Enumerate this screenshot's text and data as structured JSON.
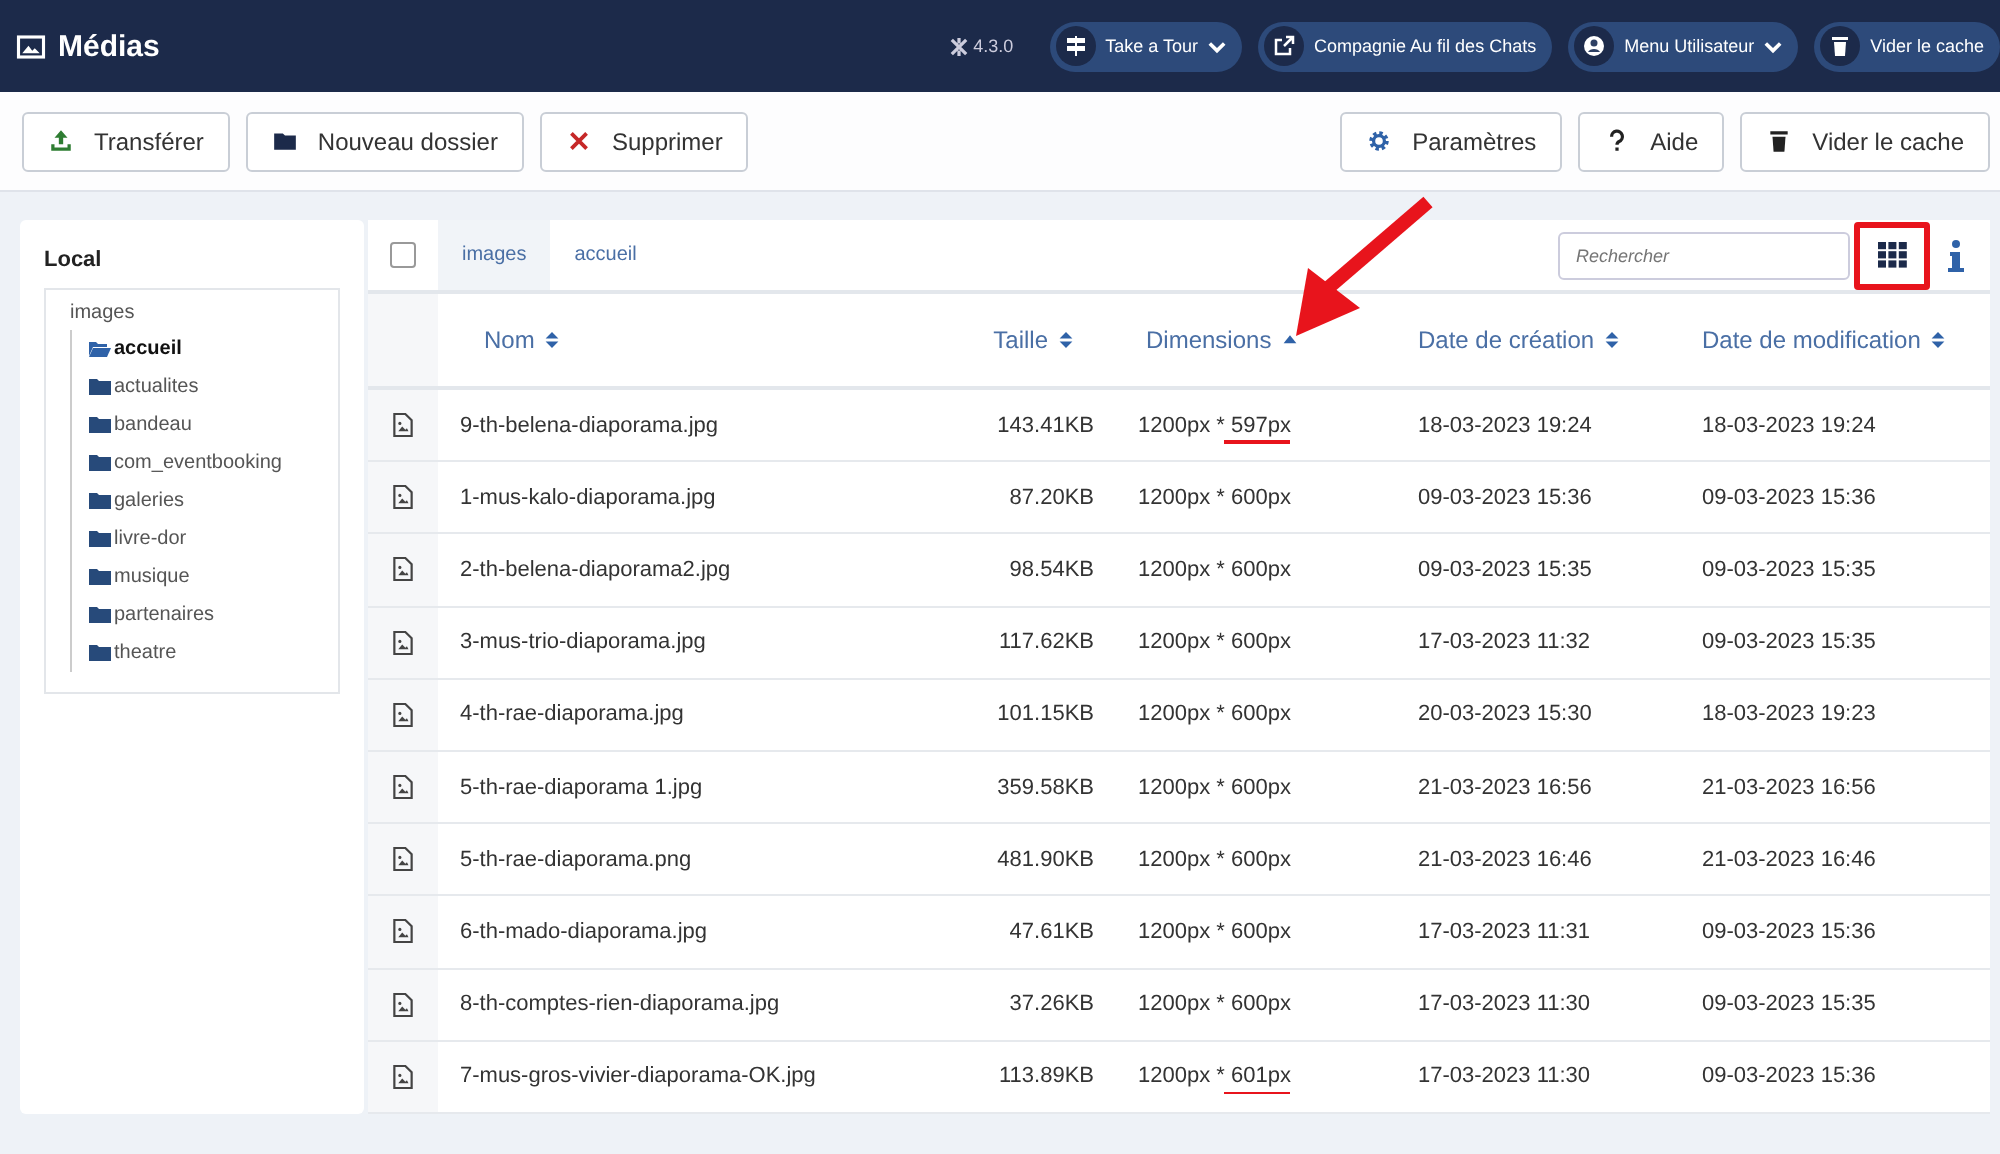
{
  "header": {
    "title": "Médias",
    "version": "4.3.0",
    "buttons": [
      {
        "label": "Take a Tour",
        "dropdown": true
      },
      {
        "label": "Compagnie Au fil des Chats",
        "dropdown": false
      },
      {
        "label": "Menu Utilisateur",
        "dropdown": true
      },
      {
        "label": "Vider le cache",
        "dropdown": false
      }
    ]
  },
  "toolbar": {
    "left": [
      {
        "label": "Transférer"
      },
      {
        "label": "Nouveau dossier"
      },
      {
        "label": "Supprimer"
      }
    ],
    "right": [
      {
        "label": "Paramètres"
      },
      {
        "label": "Aide"
      },
      {
        "label": "Vider le cache"
      }
    ]
  },
  "sidebar": {
    "title": "Local",
    "tree": {
      "label": "images",
      "children": [
        {
          "label": "accueil",
          "selected": true
        },
        {
          "label": "actualites",
          "selected": false
        },
        {
          "label": "bandeau",
          "selected": false
        },
        {
          "label": "com_eventbooking",
          "selected": false
        },
        {
          "label": "galeries",
          "selected": false
        },
        {
          "label": "livre-dor",
          "selected": false
        },
        {
          "label": "musique",
          "selected": false
        },
        {
          "label": "partenaires",
          "selected": false
        },
        {
          "label": "theatre",
          "selected": false
        }
      ]
    }
  },
  "select_all": {
    "checked": false
  },
  "breadcrumb": [
    "images",
    "accueil"
  ],
  "search": {
    "placeholder": "Rechercher"
  },
  "view_toggle": {
    "highlighted": true
  },
  "annotation_arrow": true,
  "table": {
    "columns": [
      {
        "label": "Nom",
        "sorted": false
      },
      {
        "label": "Taille",
        "sorted": false
      },
      {
        "label": "Dimensions",
        "sorted": true
      },
      {
        "label": "Date de création",
        "sorted": false
      },
      {
        "label": "Date de modification",
        "sorted": false
      }
    ],
    "rows": [
      {
        "name": "9-th-belena-diaporama.jpg",
        "size": "143.41KB",
        "dimensions": "1200px * 597px",
        "underlined": true,
        "created": "18-03-2023 19:24",
        "modified": "18-03-2023 19:24"
      },
      {
        "name": "1-mus-kalo-diaporama.jpg",
        "size": "87.20KB",
        "dimensions": "1200px * 600px",
        "underlined": false,
        "created": "09-03-2023 15:36",
        "modified": "09-03-2023 15:36"
      },
      {
        "name": "2-th-belena-diaporama2.jpg",
        "size": "98.54KB",
        "dimensions": "1200px * 600px",
        "underlined": false,
        "created": "09-03-2023 15:35",
        "modified": "09-03-2023 15:35"
      },
      {
        "name": "3-mus-trio-diaporama.jpg",
        "size": "117.62KB",
        "dimensions": "1200px * 600px",
        "underlined": false,
        "created": "17-03-2023 11:32",
        "modified": "09-03-2023 15:35"
      },
      {
        "name": "4-th-rae-diaporama.jpg",
        "size": "101.15KB",
        "dimensions": "1200px * 600px",
        "underlined": false,
        "created": "20-03-2023 15:30",
        "modified": "18-03-2023 19:23"
      },
      {
        "name": "5-th-rae-diaporama 1.jpg",
        "size": "359.58KB",
        "dimensions": "1200px * 600px",
        "underlined": false,
        "created": "21-03-2023 16:56",
        "modified": "21-03-2023 16:56"
      },
      {
        "name": "5-th-rae-diaporama.png",
        "size": "481.90KB",
        "dimensions": "1200px * 600px",
        "underlined": false,
        "created": "21-03-2023 16:46",
        "modified": "21-03-2023 16:46"
      },
      {
        "name": "6-th-mado-diaporama.jpg",
        "size": "47.61KB",
        "dimensions": "1200px * 600px",
        "underlined": false,
        "created": "17-03-2023 11:31",
        "modified": "09-03-2023 15:36"
      },
      {
        "name": "8-th-comptes-rien-diaporama.jpg",
        "size": "37.26KB",
        "dimensions": "1200px * 600px",
        "underlined": false,
        "created": "17-03-2023 11:30",
        "modified": "09-03-2023 15:35"
      },
      {
        "name": "7-mus-gros-vivier-diaporama-OK.jpg",
        "size": "113.89KB",
        "dimensions": "1200px * 601px",
        "underlined": true,
        "created": "17-03-2023 11:30",
        "modified": "09-03-2023 15:36"
      }
    ]
  }
}
